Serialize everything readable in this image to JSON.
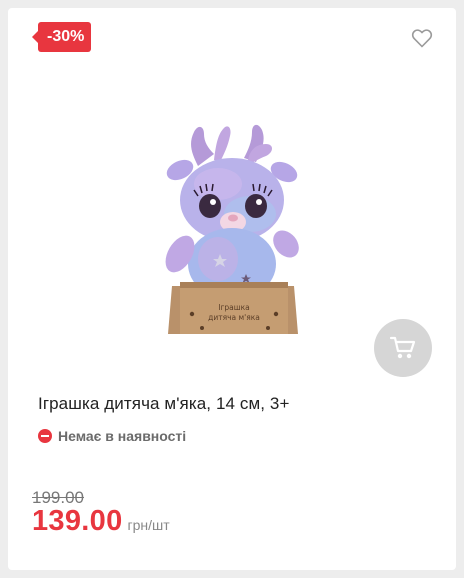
{
  "product": {
    "discount_badge": "-30%",
    "title": "Іграшка дитяча м'яка, 14 см, 3+",
    "stock_status": "Немає в наявності",
    "old_price": "199.00",
    "price": "139.00",
    "unit": "грн/шт",
    "box_text": "Іграшка дитяча м'яка"
  },
  "icons": {
    "wishlist": "heart-outline-icon",
    "cart": "shopping-cart-icon",
    "stock": "minus-circle-icon"
  },
  "colors": {
    "accent": "#e8363f",
    "cart_button": "#d6d6d6",
    "text": "#222222",
    "muted": "#6b6b6b"
  }
}
